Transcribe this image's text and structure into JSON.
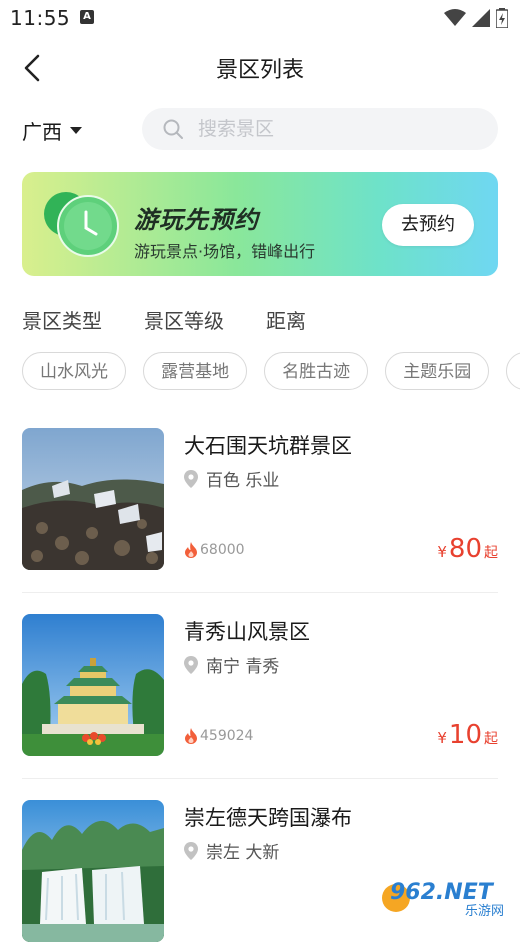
{
  "status_bar": {
    "time": "11:55",
    "notification_badge": "A"
  },
  "nav": {
    "title": "景区列表"
  },
  "region": {
    "label": "广西"
  },
  "search": {
    "placeholder": "搜索景区"
  },
  "banner": {
    "title": "游玩先预约",
    "subtitle": "游玩景点·场馆，错峰出行",
    "button_label": "去预约"
  },
  "filters": [
    {
      "label": "景区类型"
    },
    {
      "label": "景区等级"
    },
    {
      "label": "距离"
    }
  ],
  "chips": [
    {
      "label": "山水风光"
    },
    {
      "label": "露营基地"
    },
    {
      "label": "名胜古迹"
    },
    {
      "label": "主题乐园"
    }
  ],
  "items": [
    {
      "name": "大石围天坑群景区",
      "location": "百色 乐业",
      "heat": "68000",
      "currency": "¥",
      "price": "80",
      "price_suffix": "起"
    },
    {
      "name": "青秀山风景区",
      "location": "南宁 青秀",
      "heat": "459024",
      "currency": "¥",
      "price": "10",
      "price_suffix": "起"
    },
    {
      "name": "崇左德天跨国瀑布",
      "location": "崇左 大新",
      "heat": "",
      "currency": "",
      "price": "",
      "price_suffix": ""
    }
  ],
  "watermark": {
    "text_top": "962.NET",
    "text_bottom": "乐游网"
  },
  "colors": {
    "accent_price": "#e8412f",
    "banner_start": "#d9ef8d",
    "banner_end": "#6fd7f2"
  }
}
